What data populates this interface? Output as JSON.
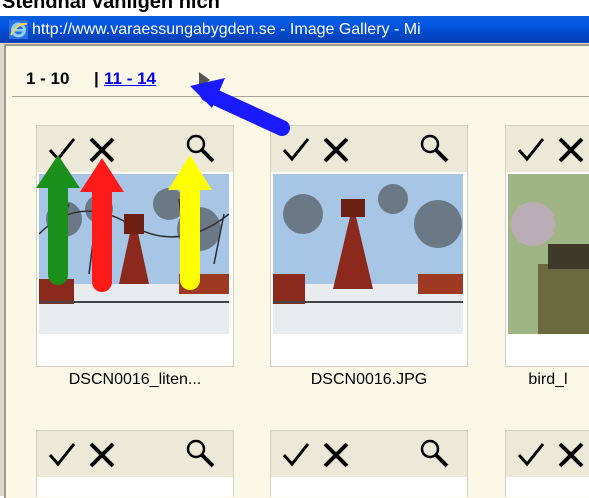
{
  "caption": "Stendhal vanligen nich",
  "window": {
    "title": "http://www.varaessungabygden.se - Image Gallery - Mi"
  },
  "pager": {
    "current": "1 - 10",
    "separator": "|",
    "next_link": "11 - 14"
  },
  "thumbnails": [
    {
      "filename": "DSCN0016_liten..."
    },
    {
      "filename": "DSCN0016.JPG"
    },
    {
      "filename": "bird_l"
    }
  ],
  "annotations": {
    "arrow_colors": [
      "#1a1aff",
      "#1a8f1a",
      "#ff1a1a",
      "#ffff00"
    ]
  }
}
